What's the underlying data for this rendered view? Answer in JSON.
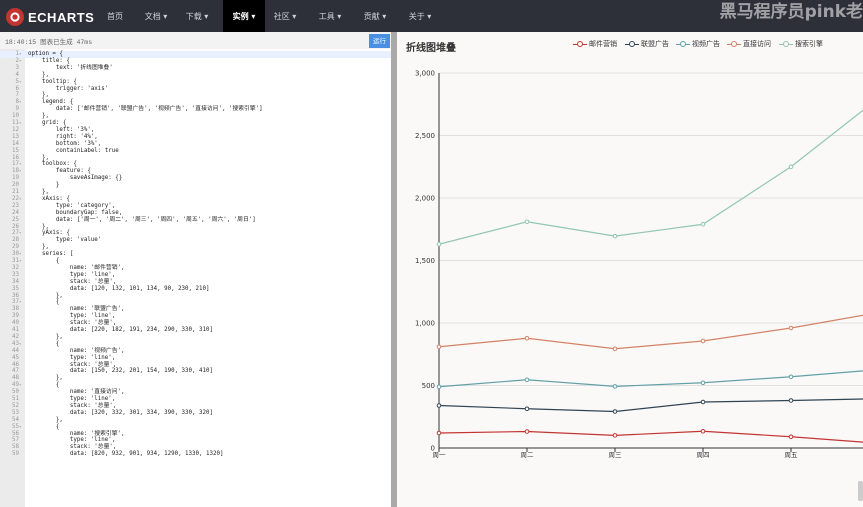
{
  "nav": {
    "logo": "ECHARTS",
    "items": [
      {
        "label": "首页",
        "active": false
      },
      {
        "label": "文档 ▾",
        "active": false
      },
      {
        "label": "下载 ▾",
        "active": false
      },
      {
        "label": "实例 ▾",
        "active": true
      },
      {
        "label": "社区 ▾",
        "active": false
      },
      {
        "label": "工具 ▾",
        "active": false
      },
      {
        "label": "贡献 ▾",
        "active": false
      },
      {
        "label": "关于 ▾",
        "active": false
      }
    ],
    "watermark": "黑马程序员pink老"
  },
  "editor": {
    "status": "18:40:15  图表已生成 47ms",
    "run_label": "运行",
    "lines": [
      {
        "n": "1",
        "fold": "▾",
        "text": "option = {"
      },
      {
        "n": "2",
        "fold": "▾",
        "text": "    title: {"
      },
      {
        "n": "3",
        "fold": "",
        "text": "        text: '折线图堆叠'"
      },
      {
        "n": "4",
        "fold": "",
        "text": "    },"
      },
      {
        "n": "5",
        "fold": "▾",
        "text": "    tooltip: {"
      },
      {
        "n": "6",
        "fold": "",
        "text": "        trigger: 'axis'"
      },
      {
        "n": "7",
        "fold": "",
        "text": "    },"
      },
      {
        "n": "8",
        "fold": "▾",
        "text": "    legend: {"
      },
      {
        "n": "9",
        "fold": "",
        "text": "        data: ['邮件营销', '联盟广告', '视频广告', '直接访问', '搜索引擎']"
      },
      {
        "n": "10",
        "fold": "",
        "text": "    },"
      },
      {
        "n": "11",
        "fold": "▾",
        "text": "    grid: {"
      },
      {
        "n": "12",
        "fold": "",
        "text": "        left: '3%',"
      },
      {
        "n": "13",
        "fold": "",
        "text": "        right: '4%',"
      },
      {
        "n": "14",
        "fold": "",
        "text": "        bottom: '3%',"
      },
      {
        "n": "15",
        "fold": "",
        "text": "        containLabel: true"
      },
      {
        "n": "16",
        "fold": "",
        "text": "    },"
      },
      {
        "n": "17",
        "fold": "▾",
        "text": "    toolbox: {"
      },
      {
        "n": "18",
        "fold": "▾",
        "text": "        feature: {"
      },
      {
        "n": "19",
        "fold": "",
        "text": "            saveAsImage: {}"
      },
      {
        "n": "20",
        "fold": "",
        "text": "        }"
      },
      {
        "n": "21",
        "fold": "",
        "text": "    },"
      },
      {
        "n": "22",
        "fold": "▾",
        "text": "    xAxis: {"
      },
      {
        "n": "23",
        "fold": "",
        "text": "        type: 'category',"
      },
      {
        "n": "24",
        "fold": "",
        "text": "        boundaryGap: false,"
      },
      {
        "n": "25",
        "fold": "",
        "text": "        data: ['周一', '周二', '周三', '周四', '周五', '周六', '周日']"
      },
      {
        "n": "26",
        "fold": "",
        "text": "    },"
      },
      {
        "n": "27",
        "fold": "▾",
        "text": "    yAxis: {"
      },
      {
        "n": "28",
        "fold": "",
        "text": "        type: 'value'"
      },
      {
        "n": "29",
        "fold": "",
        "text": "    },"
      },
      {
        "n": "30",
        "fold": "▾",
        "text": "    series: ["
      },
      {
        "n": "31",
        "fold": "▾",
        "text": "        {"
      },
      {
        "n": "32",
        "fold": "",
        "text": "            name: '邮件营销',"
      },
      {
        "n": "33",
        "fold": "",
        "text": "            type: 'line',"
      },
      {
        "n": "34",
        "fold": "",
        "text": "            stack: '总量',"
      },
      {
        "n": "35",
        "fold": "",
        "text": "            data: [120, 132, 101, 134, 90, 230, 210]"
      },
      {
        "n": "36",
        "fold": "",
        "text": "        },"
      },
      {
        "n": "37",
        "fold": "▾",
        "text": "        {"
      },
      {
        "n": "38",
        "fold": "",
        "text": "            name: '联盟广告',"
      },
      {
        "n": "39",
        "fold": "",
        "text": "            type: 'line',"
      },
      {
        "n": "40",
        "fold": "",
        "text": "            stack: '总量',"
      },
      {
        "n": "41",
        "fold": "",
        "text": "            data: [220, 182, 191, 234, 290, 330, 310]"
      },
      {
        "n": "42",
        "fold": "",
        "text": "        },"
      },
      {
        "n": "43",
        "fold": "▾",
        "text": "        {"
      },
      {
        "n": "44",
        "fold": "",
        "text": "            name: '视频广告',"
      },
      {
        "n": "45",
        "fold": "",
        "text": "            type: 'line',"
      },
      {
        "n": "46",
        "fold": "",
        "text": "            stack: '总量',"
      },
      {
        "n": "47",
        "fold": "",
        "text": "            data: [150, 232, 201, 154, 190, 330, 410]"
      },
      {
        "n": "48",
        "fold": "",
        "text": "        },"
      },
      {
        "n": "49",
        "fold": "▾",
        "text": "        {"
      },
      {
        "n": "50",
        "fold": "",
        "text": "            name: '直接访问',"
      },
      {
        "n": "51",
        "fold": "",
        "text": "            type: 'line',"
      },
      {
        "n": "52",
        "fold": "",
        "text": "            stack: '总量',"
      },
      {
        "n": "53",
        "fold": "",
        "text": "            data: [320, 332, 301, 334, 390, 330, 320]"
      },
      {
        "n": "54",
        "fold": "",
        "text": "        },"
      },
      {
        "n": "55",
        "fold": "▾",
        "text": "        {"
      },
      {
        "n": "56",
        "fold": "",
        "text": "            name: '搜索引擎',"
      },
      {
        "n": "57",
        "fold": "",
        "text": "            type: 'line',"
      },
      {
        "n": "58",
        "fold": "",
        "text": "            stack: '总量',"
      },
      {
        "n": "59",
        "fold": "",
        "text": "            data: [820, 932, 901, 934, 1290, 1330, 1320]"
      }
    ]
  },
  "chart_data": {
    "type": "line",
    "title": "折线图堆叠",
    "xlabel": "",
    "ylabel": "",
    "categories": [
      "周一",
      "周二",
      "周三",
      "周四",
      "周五"
    ],
    "ylim": [
      0,
      3000
    ],
    "yticks": [
      0,
      500,
      1000,
      1500,
      2000,
      2500,
      3000
    ],
    "ytick_labels": [
      "0",
      "500",
      "1,000",
      "1,500",
      "2,000",
      "2,500",
      "3,000"
    ],
    "stacked": true,
    "grid": true,
    "legend_position": "top-right",
    "series": [
      {
        "name": "邮件营销",
        "color": "#c23531",
        "values": [
          120,
          132,
          101,
          134,
          90
        ]
      },
      {
        "name": "联盟广告",
        "color": "#2f4554",
        "values": [
          340,
          314,
          292,
          368,
          380
        ]
      },
      {
        "name": "视频广告",
        "color": "#61a0a8",
        "values": [
          490,
          546,
          493,
          522,
          570
        ]
      },
      {
        "name": "直接访问",
        "color": "#d48265",
        "values": [
          810,
          878,
          794,
          856,
          960
        ]
      },
      {
        "name": "搜索引擎",
        "color": "#91c7ae",
        "values": [
          1630,
          1810,
          1695,
          1790,
          2250
        ]
      }
    ]
  }
}
